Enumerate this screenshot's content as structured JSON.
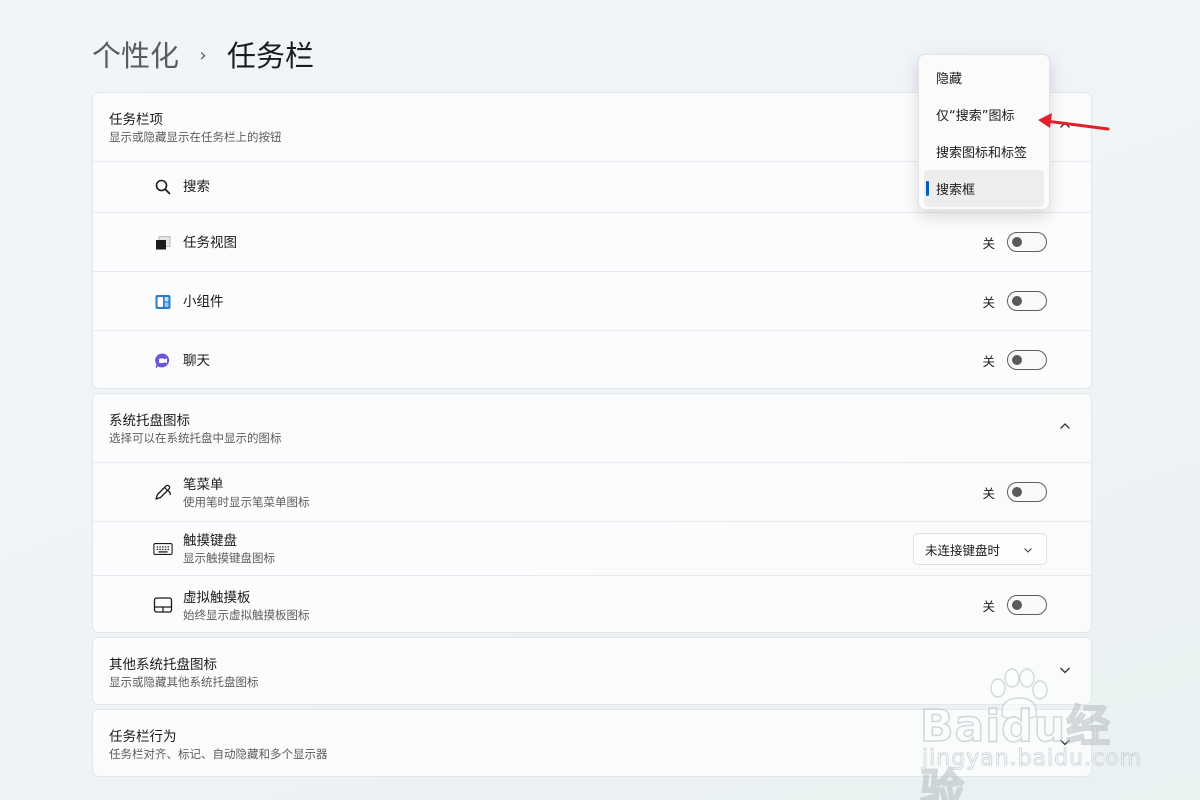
{
  "breadcrumb": {
    "parent": "个性化",
    "separator": "›",
    "current": "任务栏"
  },
  "sections": {
    "taskbar_items": {
      "title": "任务栏项",
      "subtitle": "显示或隐藏显示在任务栏上的按钮",
      "items": [
        {
          "label": "搜索",
          "icon": "search-icon"
        },
        {
          "label": "任务视图",
          "icon": "task-view-icon",
          "state": "关"
        },
        {
          "label": "小组件",
          "icon": "widgets-icon",
          "state": "关"
        },
        {
          "label": "聊天",
          "icon": "chat-icon",
          "state": "关"
        }
      ]
    },
    "system_tray": {
      "title": "系统托盘图标",
      "subtitle": "选择可以在系统托盘中显示的图标",
      "items": [
        {
          "label": "笔菜单",
          "sub": "使用笔时显示笔菜单图标",
          "icon": "pen-icon",
          "state": "关"
        },
        {
          "label": "触摸键盘",
          "sub": "显示触摸键盘图标",
          "icon": "keyboard-icon",
          "select_value": "未连接键盘时"
        },
        {
          "label": "虚拟触摸板",
          "sub": "始终显示虚拟触摸板图标",
          "icon": "touchpad-icon",
          "state": "关"
        }
      ]
    },
    "other_tray": {
      "title": "其他系统托盘图标",
      "subtitle": "显示或隐藏其他系统托盘图标"
    },
    "taskbar_behavior": {
      "title": "任务栏行为",
      "subtitle": "任务栏对齐、标记、自动隐藏和多个显示器"
    }
  },
  "search_dropdown": {
    "options": [
      "隐藏",
      "仅“搜索”图标",
      "搜索图标和标签",
      "搜索框"
    ],
    "selected": "搜索框"
  },
  "watermark": {
    "text": "Baidu经验",
    "url": "jingyan.baidu.com"
  },
  "colors": {
    "accent": "#005fb8",
    "annotation_arrow": "#e0202a"
  }
}
